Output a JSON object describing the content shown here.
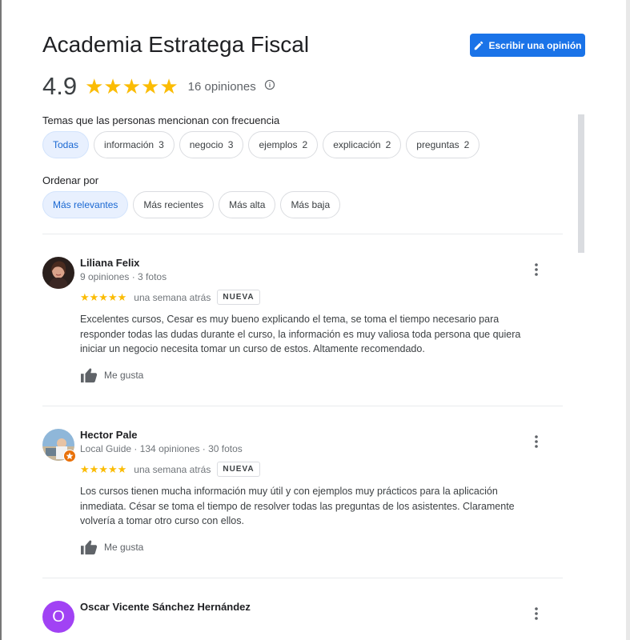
{
  "place": {
    "title": "Academia Estratega Fiscal",
    "write_review_label": "Escribir una opinión",
    "rating": "4.9",
    "stars": "★★★★★",
    "rating_value": 4.9,
    "review_count": "16 opiniones"
  },
  "topics": {
    "label": "Temas que las personas mencionan con frecuencia",
    "chips": [
      {
        "label": "Todas",
        "count": ""
      },
      {
        "label": "información",
        "count": "3"
      },
      {
        "label": "negocio",
        "count": "3"
      },
      {
        "label": "ejemplos",
        "count": "2"
      },
      {
        "label": "explicación",
        "count": "2"
      },
      {
        "label": "preguntas",
        "count": "2"
      }
    ]
  },
  "sort": {
    "label": "Ordenar por",
    "options": [
      "Más relevantes",
      "Más recientes",
      "Más alta",
      "Más baja"
    ]
  },
  "reviews": [
    {
      "name": "Liliana Felix",
      "meta": "9 opiniones · 3 fotos",
      "stars": "★★★★★",
      "stars_value": 5,
      "when": "una semana atrás",
      "badge": "NUEVA",
      "text": "Excelentes cursos, Cesar es muy bueno explicando el tema, se toma el tiempo necesario para responder todas las dudas durante el curso, la información es muy valiosa toda persona que quiera iniciar un negocio necesita tomar un curso de estos. Altamente recomendado.",
      "like_label": "Me gusta"
    },
    {
      "name": "Hector Pale",
      "meta": "Local Guide · 134 opiniones · 30 fotos",
      "stars": "★★★★★",
      "stars_value": 5,
      "when": "una semana atrás",
      "badge": "NUEVA",
      "text": "Los cursos tienen mucha información muy útil y con ejemplos muy prácticos para la aplicación inmediata. César se toma el tiempo de resolver todas las preguntas de los asistentes. Claramente volvería a tomar otro curso con ellos.",
      "like_label": "Me gusta"
    },
    {
      "name": "Oscar Vicente Sánchez Hernández",
      "avatar_letter": "O",
      "avatar_color": "#a142f4"
    }
  ],
  "colors": {
    "primary": "#1a73e8",
    "star": "#fbbc04",
    "chip_active_bg": "#e8f0fe"
  }
}
